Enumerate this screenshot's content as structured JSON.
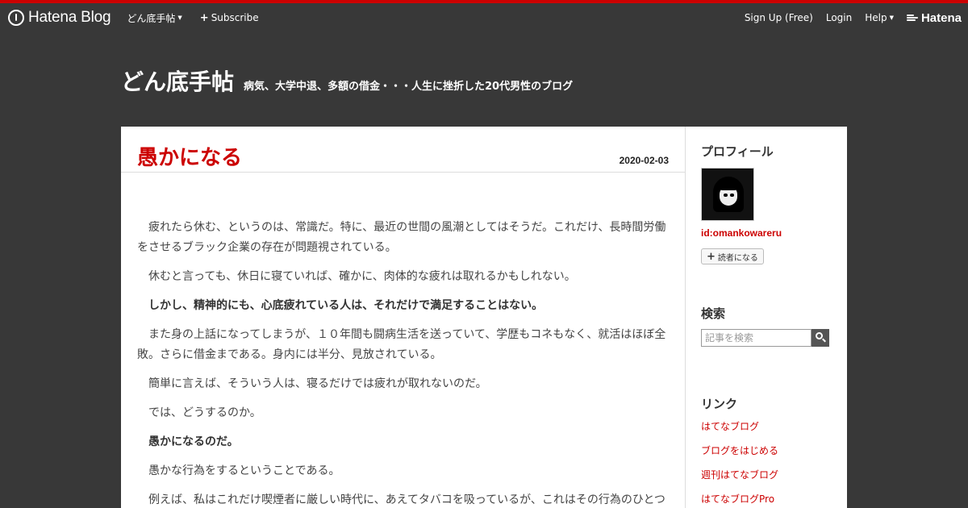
{
  "global_header": {
    "logo_text": "Hatena Blog",
    "blog_menu": "どん底手帖",
    "subscribe": "Subscribe",
    "signup": "Sign Up (Free)",
    "login": "Login",
    "help": "Help",
    "hatena": "Hatena"
  },
  "blog": {
    "title": "どん底手帖",
    "description": "病気、大学中退、多額の借金・・・人生に挫折した20代男性のブログ"
  },
  "entry": {
    "title": "愚かになる",
    "date": "2020-02-03",
    "paragraphs": [
      "疲れたら休む、というのは、常識だ。特に、最近の世間の風潮としてはそうだ。これだけ、長時間労働をさせるブラック企業の存在が問題視されている。",
      "休むと言っても、休日に寝ていれば、確かに、肉体的な疲れは取れるかもしれない。",
      "しかし、精神的にも、心底疲れている人は、それだけで満足することはない。",
      "また身の上話になってしまうが、１０年間も闘病生活を送っていて、学歴もコネもなく、就活はほぼ全敗。さらに借金まである。身内には半分、見放されている。",
      "簡単に言えば、そういう人は、寝るだけでは疲れが取れないのだ。",
      "では、どうするのか。",
      "愚かになるのだ。",
      "愚かな行為をするということである。",
      "例えば、私はこれだけ喫煙者に厳しい時代に、あえてタバコを吸っているが、これはその行為のひとつ"
    ]
  },
  "sidebar": {
    "profile_heading": "プロフィール",
    "profile_id": "id:omankowareru",
    "subscribe_button": "読者になる",
    "search_heading": "検索",
    "search_placeholder": "記事を検索",
    "links_heading": "リンク",
    "links": [
      "はてなブログ",
      "ブログをはじめる",
      "週刊はてなブログ",
      "はてなブログPro"
    ]
  },
  "colors": {
    "accent": "#cc0000",
    "background": "#383838",
    "content_bg": "#ffffff"
  }
}
